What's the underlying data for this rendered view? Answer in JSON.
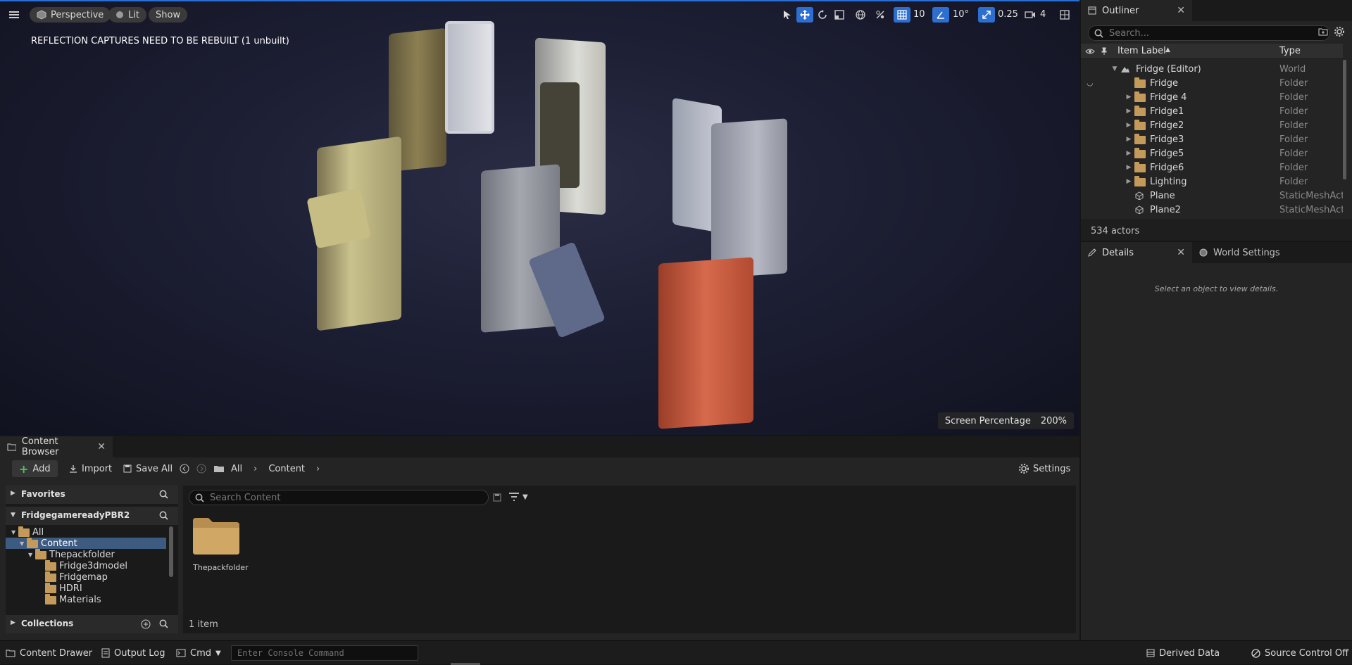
{
  "viewport": {
    "perspective_label": "Perspective",
    "lit_label": "Lit",
    "show_label": "Show",
    "grid_snap_value": "10",
    "rotation_snap_value": "10°",
    "scale_snap_value": "0.25",
    "camera_speed_value": "4",
    "warning": "REFLECTION CAPTURES NEED TO BE REBUILT (1 unbuilt)",
    "screen_percentage_label": "Screen Percentage",
    "screen_percentage_value": "200%"
  },
  "outliner": {
    "tab_label": "Outliner",
    "search_placeholder": "Search...",
    "col_label": "Item Label",
    "col_type": "Type",
    "rows": [
      {
        "label": "Fridge (Editor)",
        "type": "World"
      },
      {
        "label": "Fridge",
        "type": "Folder"
      },
      {
        "label": "Fridge 4",
        "type": "Folder"
      },
      {
        "label": "Fridge1",
        "type": "Folder"
      },
      {
        "label": "Fridge2",
        "type": "Folder"
      },
      {
        "label": "Fridge3",
        "type": "Folder"
      },
      {
        "label": "Fridge5",
        "type": "Folder"
      },
      {
        "label": "Fridge6",
        "type": "Folder"
      },
      {
        "label": "Lighting",
        "type": "Folder"
      },
      {
        "label": "Plane",
        "type": "StaticMeshActor"
      },
      {
        "label": "Plane2",
        "type": "StaticMeshActor"
      }
    ],
    "actor_count": "534 actors"
  },
  "details": {
    "tab_label": "Details",
    "world_settings_label": "World Settings",
    "empty_message": "Select an object to view details."
  },
  "content_browser": {
    "tab_label": "Content Browser",
    "add_label": "Add",
    "import_label": "Import",
    "save_all_label": "Save All",
    "breadcrumb": [
      "All",
      "Content"
    ],
    "settings_label": "Settings",
    "favorites_label": "Favorites",
    "project_label": "FridgegamereadyPBR2",
    "collections_label": "Collections",
    "search_placeholder": "Search Content",
    "tree": [
      "All",
      "Content",
      "Thepackfolder",
      "Fridge3dmodel",
      "Fridgemap",
      "HDRI",
      "Materials"
    ],
    "assets": [
      {
        "name": "Thepackfolder"
      }
    ],
    "item_count": "1 item"
  },
  "statusbar": {
    "content_drawer_label": "Content Drawer",
    "output_log_label": "Output Log",
    "cmd_label": "Cmd",
    "console_placeholder": "Enter Console Command",
    "derived_data_label": "Derived Data",
    "source_control_label": "Source Control Off"
  },
  "colors": {
    "accent": "#2d6fd0",
    "folder": "#c49a5b",
    "selection": "#3d5a80"
  }
}
